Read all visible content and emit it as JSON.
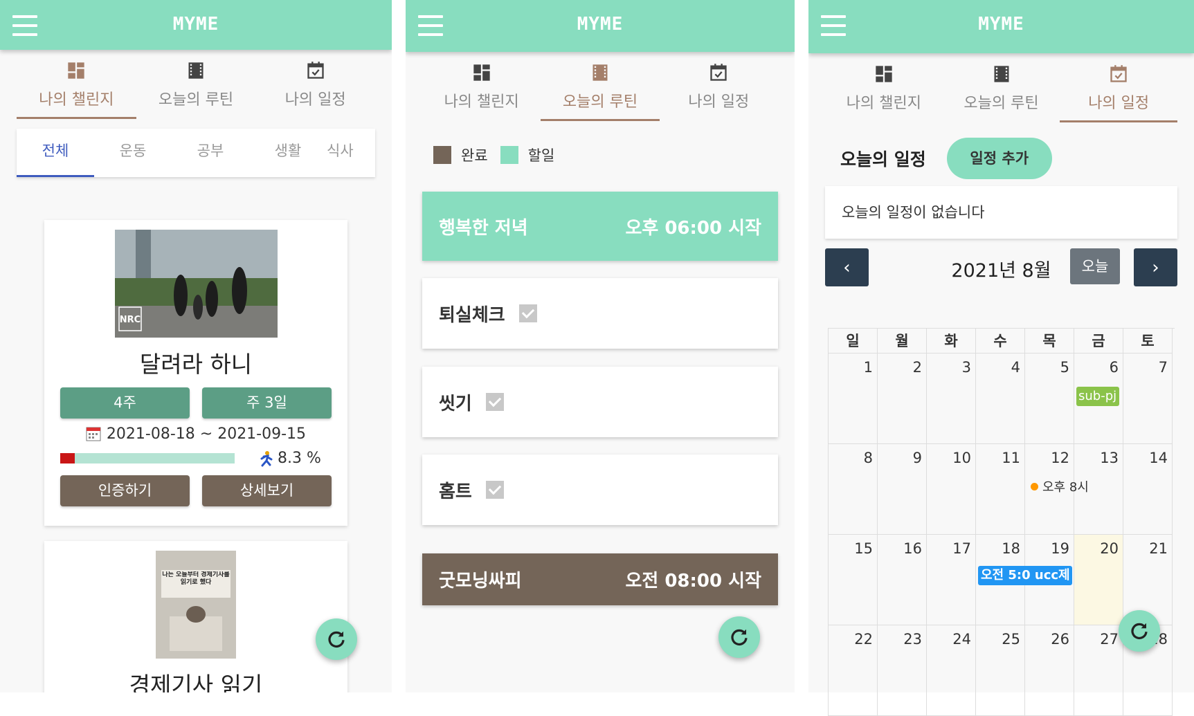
{
  "app": {
    "logo": "MYME"
  },
  "nav_tabs": [
    "나의 챌린지",
    "오늘의 루틴",
    "나의 일정"
  ],
  "challenge": {
    "categories": [
      "전체",
      "운동",
      "공부",
      "생활",
      "식사"
    ],
    "cards": [
      {
        "image_label": "NRC",
        "title": "달려라 하니",
        "duration": "4주",
        "frequency": "주 3일",
        "date_range": "2021-08-18 ~ 2021-09-15",
        "progress_percent": 8.3,
        "progress_text": "8.3 %",
        "certify_label": "인증하기",
        "detail_label": "상세보기"
      },
      {
        "image_label": "나는 오늘부터 경제기사를 읽기로 했다",
        "title": "경제기사 읽기"
      }
    ]
  },
  "routine": {
    "legend_done": "완료",
    "legend_todo": "할일",
    "groups": [
      {
        "name": "행복한 저녁",
        "time": "오후 06:00 시작"
      },
      {
        "name": "굿모닝싸피",
        "time": "오전 08:00 시작"
      }
    ],
    "items": [
      "퇴실체크",
      "씻기",
      "홈트"
    ]
  },
  "schedule": {
    "title": "오늘의 일정",
    "add_label": "일정 추가",
    "empty_text": "오늘의 일정이 없습니다",
    "month_label": "2021년 8월",
    "today_label": "오늘",
    "weekdays": [
      "일",
      "월",
      "화",
      "수",
      "목",
      "금",
      "토"
    ],
    "days": [
      [
        "1",
        "2",
        "3",
        "4",
        "5",
        "6",
        "7"
      ],
      [
        "8",
        "9",
        "10",
        "11",
        "12",
        "13",
        "14"
      ],
      [
        "15",
        "16",
        "17",
        "18",
        "19",
        "20",
        "21"
      ],
      [
        "22",
        "23",
        "24",
        "25",
        "26",
        "27",
        "28"
      ]
    ],
    "events": [
      {
        "text": "sub-pj",
        "color": "#8bc34a"
      },
      {
        "text": "오후 8시",
        "color": "#ff9800"
      },
      {
        "text": "오전 5:0 ucc제",
        "color": "#2196f3"
      }
    ]
  },
  "colors": {
    "mint": "#88ddbf",
    "brown": "#746558",
    "progress": "#c91616",
    "navy": "#2c3e50"
  },
  "icons": [
    "menu-icon",
    "dashboard-icon",
    "film-icon",
    "calendar-check-icon",
    "refresh-icon",
    "calendar-icon",
    "runner-icon",
    "chevron-left-icon",
    "chevron-right-icon"
  ]
}
